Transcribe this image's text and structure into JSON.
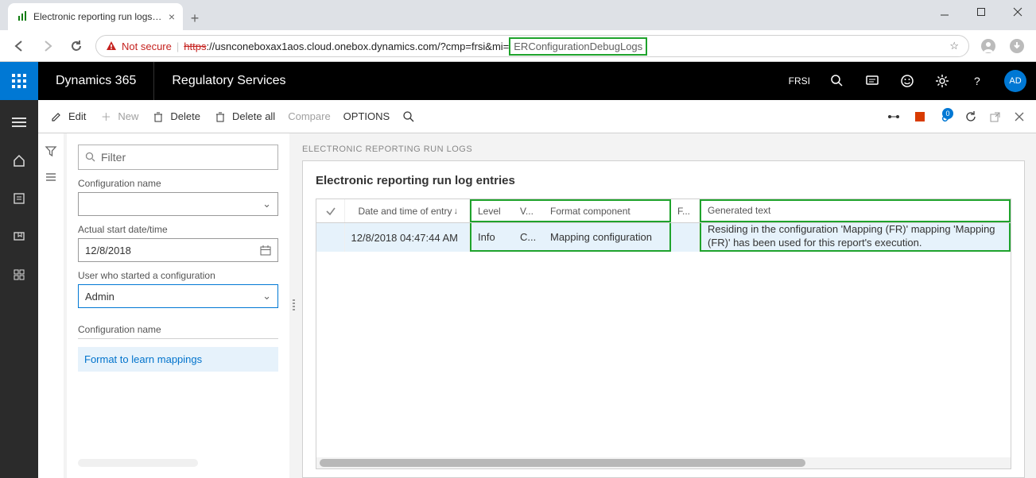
{
  "browser": {
    "tab_title": "Electronic reporting run logs -- R",
    "not_secure": "Not secure",
    "url_proto": "https",
    "url_host": "://usnconeboxax1aos.cloud.onebox.dynamics.com/?cmp=frsi&mi=",
    "url_hl": "ERConfigurationDebugLogs"
  },
  "header": {
    "brand": "Dynamics 365",
    "module": "Regulatory Services",
    "company": "FRSI",
    "avatar": "AD"
  },
  "toolbar": {
    "edit": "Edit",
    "new": "New",
    "delete": "Delete",
    "delete_all": "Delete all",
    "compare": "Compare",
    "options": "OPTIONS",
    "badge": "0"
  },
  "filter": {
    "placeholder": "Filter",
    "config_name_label": "Configuration name",
    "config_name_value": "",
    "startdate_label": "Actual start date/time",
    "startdate_value": "12/8/2018",
    "user_label": "User who started a configuration",
    "user_value": "Admin",
    "list_header": "Configuration name",
    "list_item": "Format to learn mappings"
  },
  "page": {
    "tag": "ELECTRONIC REPORTING RUN LOGS",
    "card_title": "Electronic reporting run log entries"
  },
  "grid": {
    "headers": {
      "date": "Date and time of entry",
      "level": "Level",
      "v": "V...",
      "format": "Format component",
      "f": "F...",
      "text": "Generated text"
    },
    "row": {
      "date": "12/8/2018 04:47:44 AM",
      "level": "Info",
      "v": "C...",
      "format": "Mapping configuration",
      "f": "",
      "text": "Residing in the configuration 'Mapping (FR)' mapping 'Mapping (FR)' has been used for this report's execution."
    }
  }
}
